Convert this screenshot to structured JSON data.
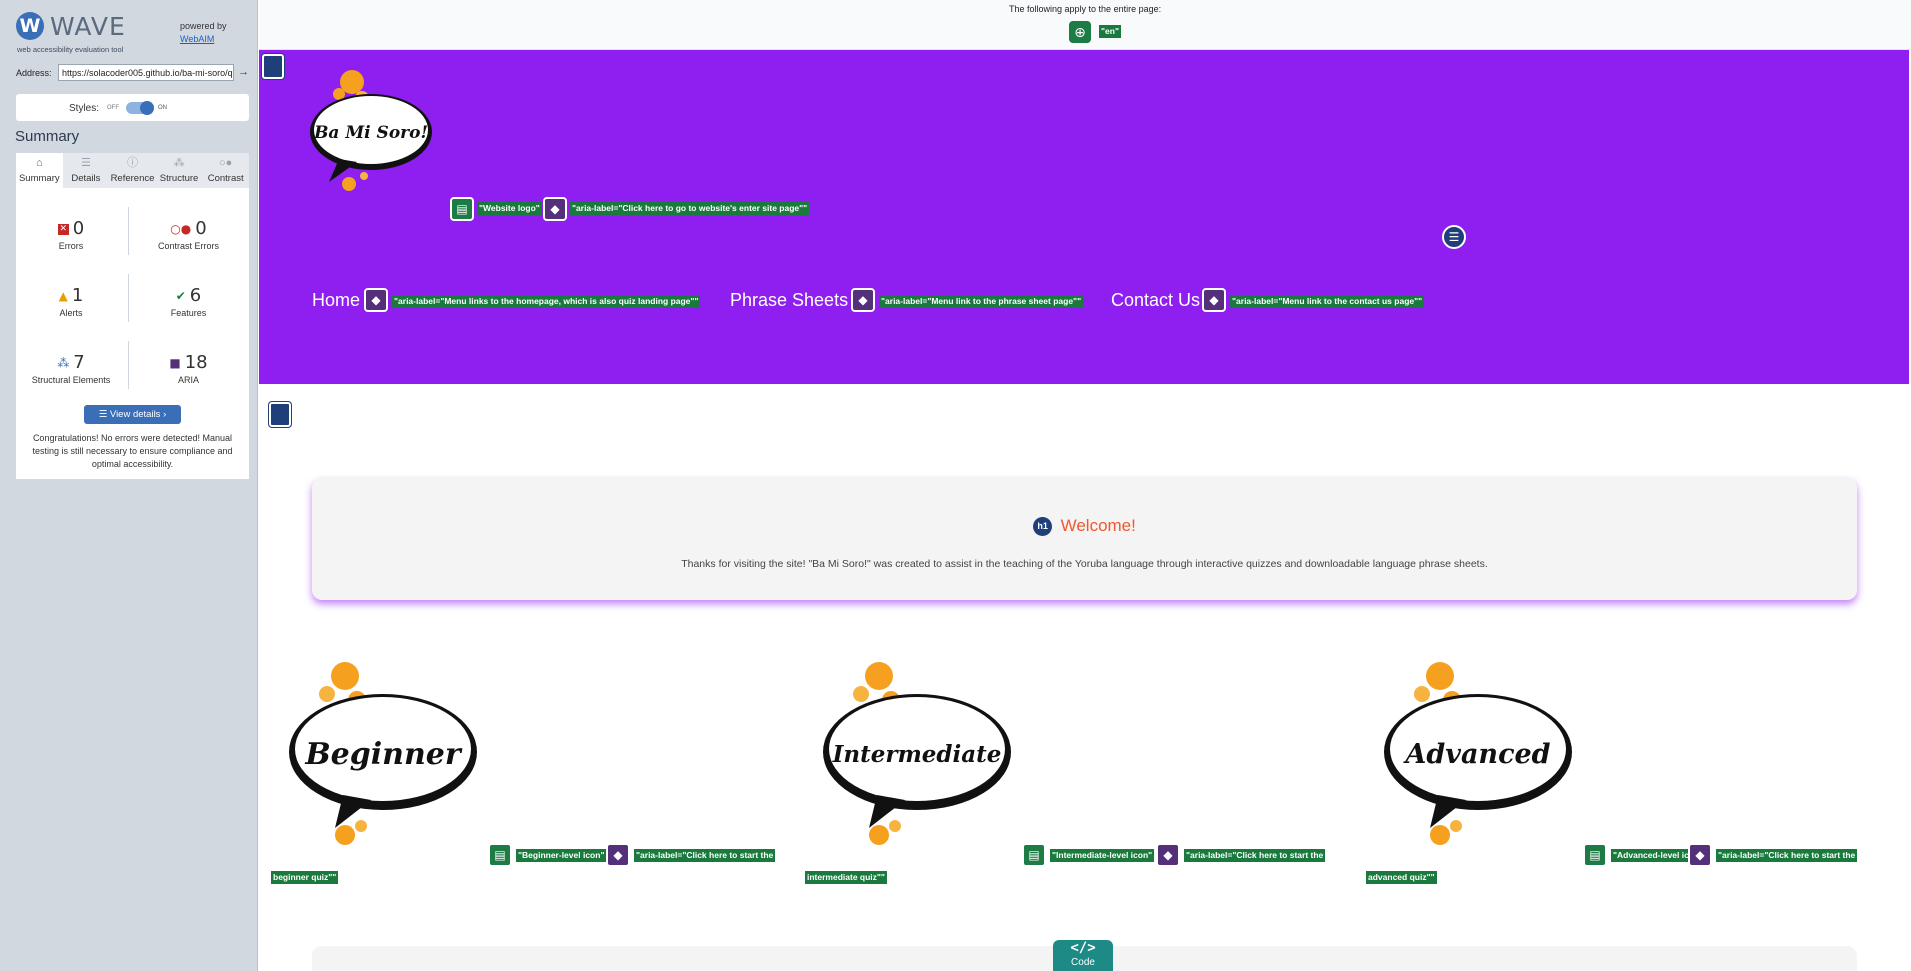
{
  "wave": {
    "name": "WAVE",
    "subtitle": "web accessibility evaluation tool",
    "powered_by": "powered by",
    "webaim": "WebAIM",
    "address_label": "Address:",
    "address_value": "https://solacoder005.github.io/ba-mi-soro/q",
    "styles_label": "Styles:",
    "styles_off": "OFF",
    "styles_on": "ON",
    "summary_title": "Summary",
    "tabs": [
      {
        "label": "Summary",
        "icon": "home-icon"
      },
      {
        "label": "Details",
        "icon": "list-icon"
      },
      {
        "label": "Reference",
        "icon": "info-icon"
      },
      {
        "label": "Structure",
        "icon": "structure-icon"
      },
      {
        "label": "Contrast",
        "icon": "contrast-icon"
      }
    ],
    "stats": {
      "errors": {
        "count": "0",
        "label": "Errors"
      },
      "contrast": {
        "count": "0",
        "label": "Contrast Errors"
      },
      "alerts": {
        "count": "1",
        "label": "Alerts"
      },
      "features": {
        "count": "6",
        "label": "Features"
      },
      "structural": {
        "count": "7",
        "label": "Structural Elements"
      },
      "aria": {
        "count": "18",
        "label": "ARIA"
      }
    },
    "view_details": "View details ›",
    "congrats": "Congratulations! No errors were detected! Manual testing is still necessary to ensure compliance and optimal accessibility.",
    "colors": {
      "accent": "#3a6fb7",
      "sidebar": "#d2d8e0",
      "feature": "#1d7b46",
      "aria": "#55307a"
    }
  },
  "page": {
    "apply_text": "The following apply to the entire page:",
    "lang_label": "\"en\"",
    "logo_label": "\"Website logo\"",
    "logo_aria": "\"aria-label=\"Click here to go to website's enter site page\"\"",
    "nav": [
      {
        "label": "Home",
        "aria": "\"aria-label=\"Menu links to the homepage, which is also quiz landing page\"\""
      },
      {
        "label": "Phrase Sheets",
        "aria": "\"aria-label=\"Menu link to the phrase sheet page\"\""
      },
      {
        "label": "Contact Us",
        "aria": "\"aria-label=\"Menu link to the contact us page\"\""
      }
    ],
    "welcome_title": "Welcome!",
    "h1_badge": "h1",
    "welcome_text": "Thanks for visiting the site! \"Ba Mi Soro!\" was created to assist in the teaching of the Yoruba language through interactive quizzes and downloadable language phrase sheets.",
    "brand_logo_text": "Ba Mi Soro!",
    "levels": [
      {
        "word": "Beginner",
        "alt": "\"Beginner-level icon\"",
        "aria1": "\"aria-label=\"Click here to start the",
        "aria2": "beginner quiz\"\""
      },
      {
        "word": "Intermediate",
        "alt": "\"Intermediate-level icon\"",
        "aria1": "\"aria-label=\"Click here to start the",
        "aria2": "intermediate quiz\"\""
      },
      {
        "word": "Advanced",
        "alt": "\"Advanced-level icon\"",
        "aria1": "\"aria-label=\"Click here to start the",
        "aria2": "advanced quiz\"\""
      }
    ],
    "code_label": "Code",
    "code_symbol": "</>",
    "colors": {
      "header": "#8f1ef0",
      "title": "#f0582b",
      "splash": "#f6a020"
    }
  }
}
